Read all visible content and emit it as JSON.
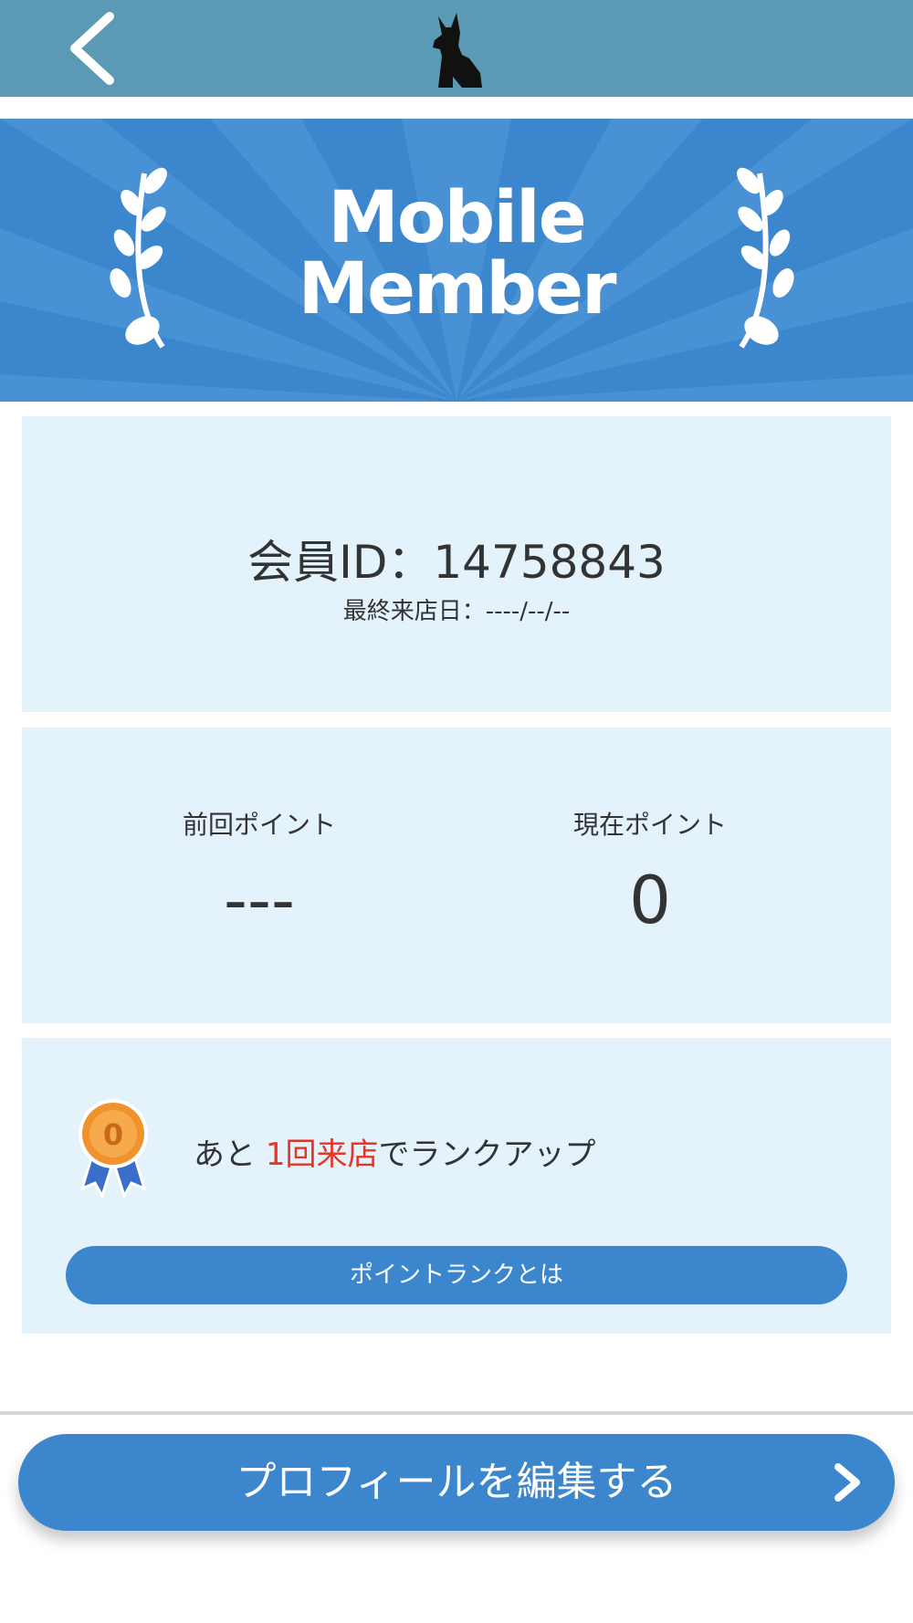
{
  "header": {
    "back_icon": "chevron-left-icon",
    "logo_icon": "dog-silhouette-icon"
  },
  "banner": {
    "title_line1": "Mobile",
    "title_line2": "Member",
    "decoration_icon": "laurel-icon"
  },
  "member": {
    "id_text": "会員ID：14758843",
    "last_visit_text": "最終来店日：----/--/--"
  },
  "points": {
    "previous_label": "前回ポイント",
    "previous_value": "---",
    "current_label": "現在ポイント",
    "current_value": "0"
  },
  "rank": {
    "medal_icon": "bronze-medal-icon",
    "medal_number": "0",
    "text_prefix": "あと ",
    "text_highlight": "1回来店",
    "text_suffix": "でランクアップ",
    "highlight_color": "#e53527",
    "info_button_label": "ポイントランクとは"
  },
  "footer": {
    "edit_profile_label": "プロフィールを編集する",
    "edit_profile_icon": "chevron-right-icon"
  },
  "colors": {
    "header_bg": "#5a9ab5",
    "accent": "#3b86cc",
    "panel_bg": "#e3f2fb"
  }
}
